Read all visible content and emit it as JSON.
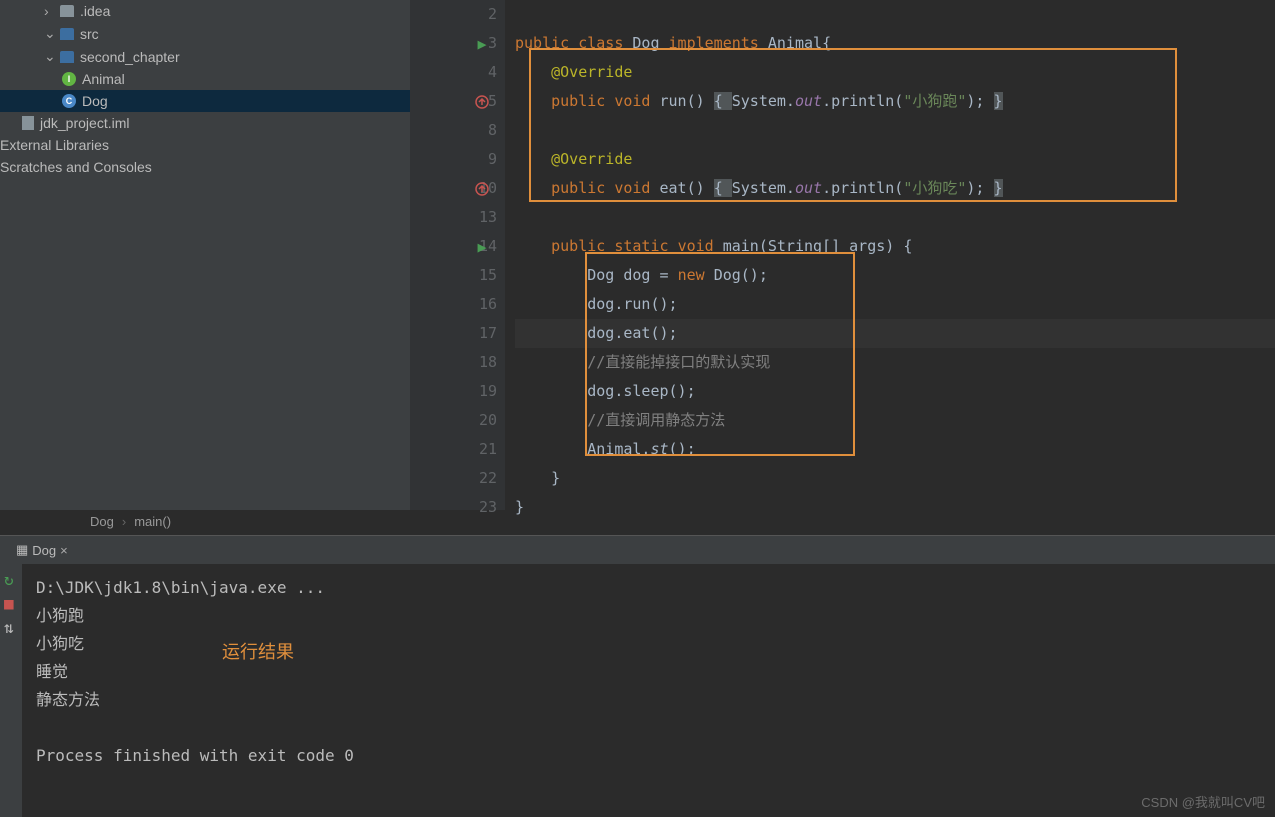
{
  "tree": {
    "idea": ".idea",
    "src": "src",
    "chapter": "second_chapter",
    "animal": "Animal",
    "dog": "Dog",
    "iml": "jdk_project.iml",
    "ext": "External Libraries",
    "scratch": "Scratches and Consoles"
  },
  "lines": [
    "2",
    "3",
    "4",
    "5",
    "8",
    "9",
    "10",
    "13",
    "14",
    "15",
    "16",
    "17",
    "18",
    "19",
    "20",
    "21",
    "22",
    "23"
  ],
  "code": {
    "l3": {
      "kw1": "public ",
      "kw2": "class ",
      "cls": "Dog ",
      "kw3": "implements ",
      "iface": "Animal",
      "end": "{"
    },
    "l4": {
      "ann": "@Override"
    },
    "l5": {
      "kw1": "public ",
      "kw2": "void ",
      "m": "run",
      "p": "() ",
      "b1": "{ ",
      "sys": "System.",
      "out": "out",
      "dot": ".",
      "pr": "println(",
      "str": "\"小狗跑\"",
      "end": "); ",
      "b2": "}"
    },
    "l9": {
      "ann": "@Override"
    },
    "l10": {
      "kw1": "public ",
      "kw2": "void ",
      "m": "eat",
      "p": "() ",
      "b1": "{ ",
      "sys": "System.",
      "out": "out",
      "dot": ".",
      "pr": "println(",
      "str": "\"小狗吃\"",
      "end": "); ",
      "b2": "}"
    },
    "l14": {
      "kw1": "public ",
      "kw2": "static ",
      "kw3": "void ",
      "m": "main",
      "p": "(String[] args) {"
    },
    "l15": {
      "t": "Dog dog = ",
      "kw": "new ",
      "r": "Dog();"
    },
    "l16": "dog.run();",
    "l17": "dog.eat();",
    "l18": "//直接能掉接口的默认实现",
    "l19": "dog.sleep();",
    "l20": "//直接调用静态方法",
    "l21": {
      "a": "Animal.",
      "m": "st",
      "r": "();"
    },
    "l22": "}",
    "l23": "}"
  },
  "breadcrumb": {
    "a": "Dog",
    "b": "main()"
  },
  "console": {
    "tab": "Dog",
    "cmd": "D:\\JDK\\jdk1.8\\bin\\java.exe ...",
    "o1": "小狗跑",
    "o2": "小狗吃",
    "o3": "睡觉",
    "o4": "静态方法",
    "exit": "Process finished with exit code 0",
    "label": "运行结果"
  },
  "watermark": "CSDN @我就叫CV吧"
}
